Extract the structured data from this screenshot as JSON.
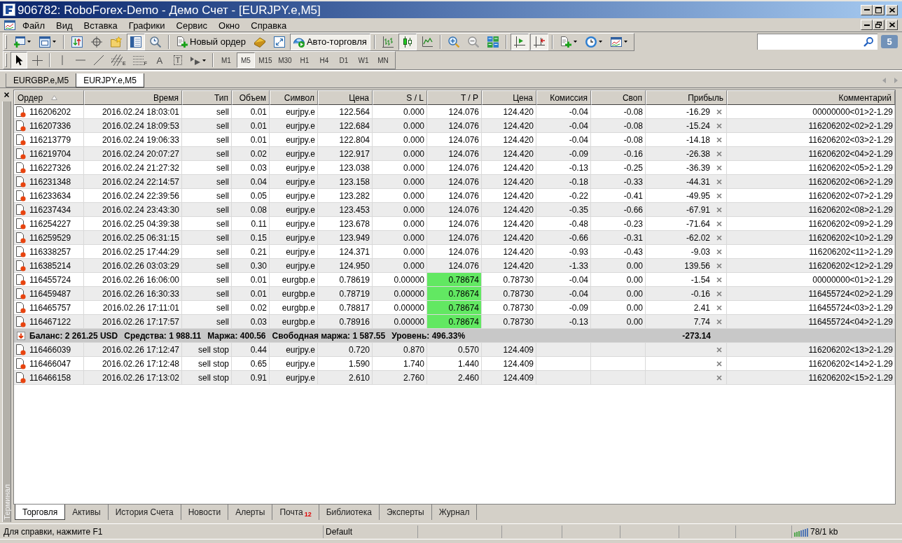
{
  "window": {
    "title": "906782: RoboForex-Demo - Демо Счет - [EURJPY.e,M5]"
  },
  "menu": [
    "Файл",
    "Вид",
    "Вставка",
    "Графики",
    "Сервис",
    "Окно",
    "Справка"
  ],
  "toolbar": {
    "buttons": [
      {
        "kind": "new_chart",
        "pressed": false
      },
      {
        "kind": "profiles",
        "pressed": false
      },
      {
        "kind": "separator"
      },
      {
        "kind": "market_watch",
        "pressed": false
      },
      {
        "kind": "data_window",
        "pressed": false
      },
      {
        "kind": "navigator",
        "pressed": false
      },
      {
        "kind": "terminal",
        "pressed": true
      },
      {
        "kind": "tester",
        "pressed": false
      },
      {
        "kind": "separator"
      },
      {
        "kind": "new_order",
        "label": "Новый ордер",
        "pressed": false
      },
      {
        "kind": "metaeditor",
        "pressed": false
      },
      {
        "kind": "fullscreen",
        "pressed": false
      },
      {
        "kind": "autotrading",
        "label": "Авто-торговля",
        "pressed": true
      },
      {
        "kind": "separator"
      },
      {
        "kind": "bar_chart",
        "pressed": false
      },
      {
        "kind": "candles",
        "pressed": true
      },
      {
        "kind": "line_chart",
        "pressed": false
      },
      {
        "kind": "separator"
      },
      {
        "kind": "zoom_in",
        "pressed": false
      },
      {
        "kind": "zoom_out",
        "pressed": false
      },
      {
        "kind": "tile",
        "pressed": false
      },
      {
        "kind": "separator"
      },
      {
        "kind": "autoscroll",
        "pressed": true
      },
      {
        "kind": "chart_shift",
        "pressed": true
      },
      {
        "kind": "separator"
      },
      {
        "kind": "indicators",
        "pressed": false
      },
      {
        "kind": "periods",
        "pressed": false
      },
      {
        "kind": "templates",
        "pressed": false
      }
    ],
    "messages": "5"
  },
  "drawing_toolbar": {
    "tools": [
      {
        "kind": "cursor",
        "pressed": true
      },
      {
        "kind": "crosshair",
        "pressed": false
      },
      {
        "kind": "separator"
      },
      {
        "kind": "vertical_line",
        "pressed": false
      },
      {
        "kind": "horizontal_line",
        "pressed": false
      },
      {
        "kind": "trend_line",
        "pressed": false
      },
      {
        "kind": "fibo_channel",
        "label": "E",
        "pressed": false
      },
      {
        "kind": "fibo",
        "label": "F",
        "pressed": false
      },
      {
        "kind": "text",
        "label": "A",
        "pressed": false
      },
      {
        "kind": "text_label",
        "label": "T",
        "pressed": false
      },
      {
        "kind": "shapes",
        "pressed": false
      }
    ],
    "timeframes": [
      {
        "label": "M1",
        "selected": false
      },
      {
        "label": "M5",
        "selected": true
      },
      {
        "label": "M15",
        "selected": false
      },
      {
        "label": "M30",
        "selected": false
      },
      {
        "label": "H1",
        "selected": false
      },
      {
        "label": "H4",
        "selected": false
      },
      {
        "label": "D1",
        "selected": false
      },
      {
        "label": "W1",
        "selected": false
      },
      {
        "label": "MN",
        "selected": false
      }
    ]
  },
  "chart_tabs": [
    {
      "label": "EURGBP.e,M5",
      "selected": false
    },
    {
      "label": "EURJPY.e,M5",
      "selected": true
    }
  ],
  "terminal": {
    "title": "Терминал",
    "columns": [
      {
        "label": "Ордер",
        "sorted": true
      },
      {
        "label": "Время",
        "sorted": false
      },
      {
        "label": "Тип",
        "sorted": false
      },
      {
        "label": "Объем",
        "sorted": false
      },
      {
        "label": "Символ",
        "sorted": false
      },
      {
        "label": "Цена",
        "sorted": false
      },
      {
        "label": "S / L",
        "sorted": false
      },
      {
        "label": "T / P",
        "sorted": false
      },
      {
        "label": "Цена",
        "sorted": false
      },
      {
        "label": "Комиссия",
        "sorted": false
      },
      {
        "label": "Своп",
        "sorted": false
      },
      {
        "label": "Прибыль",
        "sorted": false
      },
      {
        "label": "Комментарий",
        "sorted": false
      }
    ],
    "rows": [
      {
        "kind": "position",
        "order": "116206202",
        "time": "2016.02.24 18:03:01",
        "type": "sell",
        "volume": "0.01",
        "symbol": "eurjpy.e",
        "price": "122.564",
        "sl": "0.000",
        "tp": "124.076",
        "tp_highlighted": false,
        "market_price": "124.420",
        "commission": "-0.04",
        "swap": "-0.08",
        "profit": "-16.29",
        "comment": "00000000<01>2-1.29"
      },
      {
        "kind": "position",
        "order": "116207336",
        "time": "2016.02.24 18:09:53",
        "type": "sell",
        "volume": "0.01",
        "symbol": "eurjpy.e",
        "price": "122.684",
        "sl": "0.000",
        "tp": "124.076",
        "tp_highlighted": false,
        "market_price": "124.420",
        "commission": "-0.04",
        "swap": "-0.08",
        "profit": "-15.24",
        "comment": "116206202<02>2-1.29"
      },
      {
        "kind": "position",
        "order": "116213779",
        "time": "2016.02.24 19:06:33",
        "type": "sell",
        "volume": "0.01",
        "symbol": "eurjpy.e",
        "price": "122.804",
        "sl": "0.000",
        "tp": "124.076",
        "tp_highlighted": false,
        "market_price": "124.420",
        "commission": "-0.04",
        "swap": "-0.08",
        "profit": "-14.18",
        "comment": "116206202<03>2-1.29"
      },
      {
        "kind": "position",
        "order": "116219704",
        "time": "2016.02.24 20:07:27",
        "type": "sell",
        "volume": "0.02",
        "symbol": "eurjpy.e",
        "price": "122.917",
        "sl": "0.000",
        "tp": "124.076",
        "tp_highlighted": false,
        "market_price": "124.420",
        "commission": "-0.09",
        "swap": "-0.16",
        "profit": "-26.38",
        "comment": "116206202<04>2-1.29"
      },
      {
        "kind": "position",
        "order": "116227326",
        "time": "2016.02.24 21:27:32",
        "type": "sell",
        "volume": "0.03",
        "symbol": "eurjpy.e",
        "price": "123.038",
        "sl": "0.000",
        "tp": "124.076",
        "tp_highlighted": false,
        "market_price": "124.420",
        "commission": "-0.13",
        "swap": "-0.25",
        "profit": "-36.39",
        "comment": "116206202<05>2-1.29"
      },
      {
        "kind": "position",
        "order": "116231348",
        "time": "2016.02.24 22:14:57",
        "type": "sell",
        "volume": "0.04",
        "symbol": "eurjpy.e",
        "price": "123.158",
        "sl": "0.000",
        "tp": "124.076",
        "tp_highlighted": false,
        "market_price": "124.420",
        "commission": "-0.18",
        "swap": "-0.33",
        "profit": "-44.31",
        "comment": "116206202<06>2-1.29"
      },
      {
        "kind": "position",
        "order": "116233634",
        "time": "2016.02.24 22:39:56",
        "type": "sell",
        "volume": "0.05",
        "symbol": "eurjpy.e",
        "price": "123.282",
        "sl": "0.000",
        "tp": "124.076",
        "tp_highlighted": false,
        "market_price": "124.420",
        "commission": "-0.22",
        "swap": "-0.41",
        "profit": "-49.95",
        "comment": "116206202<07>2-1.29"
      },
      {
        "kind": "position",
        "order": "116237434",
        "time": "2016.02.24 23:43:30",
        "type": "sell",
        "volume": "0.08",
        "symbol": "eurjpy.e",
        "price": "123.453",
        "sl": "0.000",
        "tp": "124.076",
        "tp_highlighted": false,
        "market_price": "124.420",
        "commission": "-0.35",
        "swap": "-0.66",
        "profit": "-67.91",
        "comment": "116206202<08>2-1.29"
      },
      {
        "kind": "position",
        "order": "116254227",
        "time": "2016.02.25 04:39:38",
        "type": "sell",
        "volume": "0.11",
        "symbol": "eurjpy.e",
        "price": "123.678",
        "sl": "0.000",
        "tp": "124.076",
        "tp_highlighted": false,
        "market_price": "124.420",
        "commission": "-0.48",
        "swap": "-0.23",
        "profit": "-71.64",
        "comment": "116206202<09>2-1.29"
      },
      {
        "kind": "position",
        "order": "116259529",
        "time": "2016.02.25 06:31:15",
        "type": "sell",
        "volume": "0.15",
        "symbol": "eurjpy.e",
        "price": "123.949",
        "sl": "0.000",
        "tp": "124.076",
        "tp_highlighted": false,
        "market_price": "124.420",
        "commission": "-0.66",
        "swap": "-0.31",
        "profit": "-62.02",
        "comment": "116206202<10>2-1.29"
      },
      {
        "kind": "position",
        "order": "116338257",
        "time": "2016.02.25 17:44:29",
        "type": "sell",
        "volume": "0.21",
        "symbol": "eurjpy.e",
        "price": "124.371",
        "sl": "0.000",
        "tp": "124.076",
        "tp_highlighted": false,
        "market_price": "124.420",
        "commission": "-0.93",
        "swap": "-0.43",
        "profit": "-9.03",
        "comment": "116206202<11>2-1.29"
      },
      {
        "kind": "position",
        "order": "116385214",
        "time": "2016.02.26 03:03:29",
        "type": "sell",
        "volume": "0.30",
        "symbol": "eurjpy.e",
        "price": "124.950",
        "sl": "0.000",
        "tp": "124.076",
        "tp_highlighted": false,
        "market_price": "124.420",
        "commission": "-1.33",
        "swap": "0.00",
        "profit": "139.56",
        "comment": "116206202<12>2-1.29"
      },
      {
        "kind": "position",
        "order": "116455724",
        "time": "2016.02.26 16:06:00",
        "type": "sell",
        "volume": "0.01",
        "symbol": "eurgbp.e",
        "price": "0.78619",
        "sl": "0.00000",
        "tp": "0.78674",
        "tp_highlighted": true,
        "market_price": "0.78730",
        "commission": "-0.04",
        "swap": "0.00",
        "profit": "-1.54",
        "comment": "00000000<01>2-1.29"
      },
      {
        "kind": "position",
        "order": "116459487",
        "time": "2016.02.26 16:30:33",
        "type": "sell",
        "volume": "0.01",
        "symbol": "eurgbp.e",
        "price": "0.78719",
        "sl": "0.00000",
        "tp": "0.78674",
        "tp_highlighted": true,
        "market_price": "0.78730",
        "commission": "-0.04",
        "swap": "0.00",
        "profit": "-0.16",
        "comment": "116455724<02>2-1.29"
      },
      {
        "kind": "position",
        "order": "116465757",
        "time": "2016.02.26 17:11:01",
        "type": "sell",
        "volume": "0.02",
        "symbol": "eurgbp.e",
        "price": "0.78817",
        "sl": "0.00000",
        "tp": "0.78674",
        "tp_highlighted": true,
        "market_price": "0.78730",
        "commission": "-0.09",
        "swap": "0.00",
        "profit": "2.41",
        "comment": "116455724<03>2-1.29"
      },
      {
        "kind": "position",
        "order": "116467122",
        "time": "2016.02.26 17:17:57",
        "type": "sell",
        "volume": "0.03",
        "symbol": "eurgbp.e",
        "price": "0.78916",
        "sl": "0.00000",
        "tp": "0.78674",
        "tp_highlighted": true,
        "market_price": "0.78730",
        "commission": "-0.13",
        "swap": "0.00",
        "profit": "7.74",
        "comment": "116455724<04>2-1.29"
      },
      {
        "kind": "summary",
        "items": [
          "Баланс: 2 261.25 USD",
          "Средства: 1 988.11",
          "Маржа: 400.56",
          "Свободная маржа: 1 587.55",
          "Уровень: 496.33%"
        ],
        "profit": "-273.14"
      },
      {
        "kind": "pending",
        "order": "116466039",
        "time": "2016.02.26 17:12:47",
        "type": "sell stop",
        "volume": "0.44",
        "symbol": "eurjpy.e",
        "price": "0.720",
        "sl": "0.870",
        "tp": "0.570",
        "tp_highlighted": false,
        "market_price": "124.409",
        "comment": "116206202<13>2-1.29"
      },
      {
        "kind": "pending",
        "order": "116466047",
        "time": "2016.02.26 17:12:48",
        "type": "sell stop",
        "volume": "0.65",
        "symbol": "eurjpy.e",
        "price": "1.590",
        "sl": "1.740",
        "tp": "1.440",
        "tp_highlighted": false,
        "market_price": "124.409",
        "comment": "116206202<14>2-1.29"
      },
      {
        "kind": "pending",
        "order": "116466158",
        "time": "2016.02.26 17:13:02",
        "type": "sell stop",
        "volume": "0.91",
        "symbol": "eurjpy.e",
        "price": "2.610",
        "sl": "2.760",
        "tp": "2.460",
        "tp_highlighted": false,
        "market_price": "124.409",
        "comment": "116206202<15>2-1.29"
      }
    ],
    "tabs": [
      {
        "label": "Торговля",
        "selected": true
      },
      {
        "label": "Активы",
        "selected": false
      },
      {
        "label": "История Счета",
        "selected": false
      },
      {
        "label": "Новости",
        "selected": false
      },
      {
        "label": "Алерты",
        "selected": false
      },
      {
        "label": "Почта",
        "badge": "12",
        "selected": false
      },
      {
        "label": "Библиотека",
        "selected": false
      },
      {
        "label": "Эксперты",
        "selected": false
      },
      {
        "label": "Журнал",
        "selected": false
      }
    ]
  },
  "status_bar": {
    "help": "Для справки, нажмите F1",
    "profile": "Default",
    "traffic": "78/1 kb"
  }
}
